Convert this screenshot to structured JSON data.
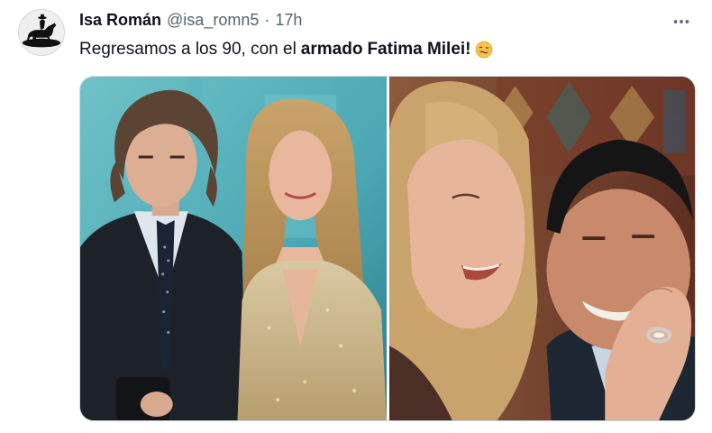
{
  "author": {
    "display_name": "Isa Román",
    "handle": "@isa_romn5",
    "separator": "·",
    "timestamp": "17h",
    "avatar_icon": "horse-rider-silhouette-icon"
  },
  "tweet": {
    "text_prefix": "Regresamos a los 90, con el",
    "text_bold_1": "armado",
    "text_bold_2": "Fatima Milei!",
    "emoji": "woozy-face-emoji"
  },
  "menu": {
    "icon": "more-horizontal-icon"
  },
  "media": {
    "photos": [
      {
        "subject": "man with curly hair in suit beside woman in gold dress"
      },
      {
        "subject": "blonde woman embracing smiling older man"
      }
    ]
  },
  "colors": {
    "text_primary": "#0f1419",
    "text_secondary": "#536471",
    "border": "#cfd9de",
    "background": "#ffffff"
  }
}
